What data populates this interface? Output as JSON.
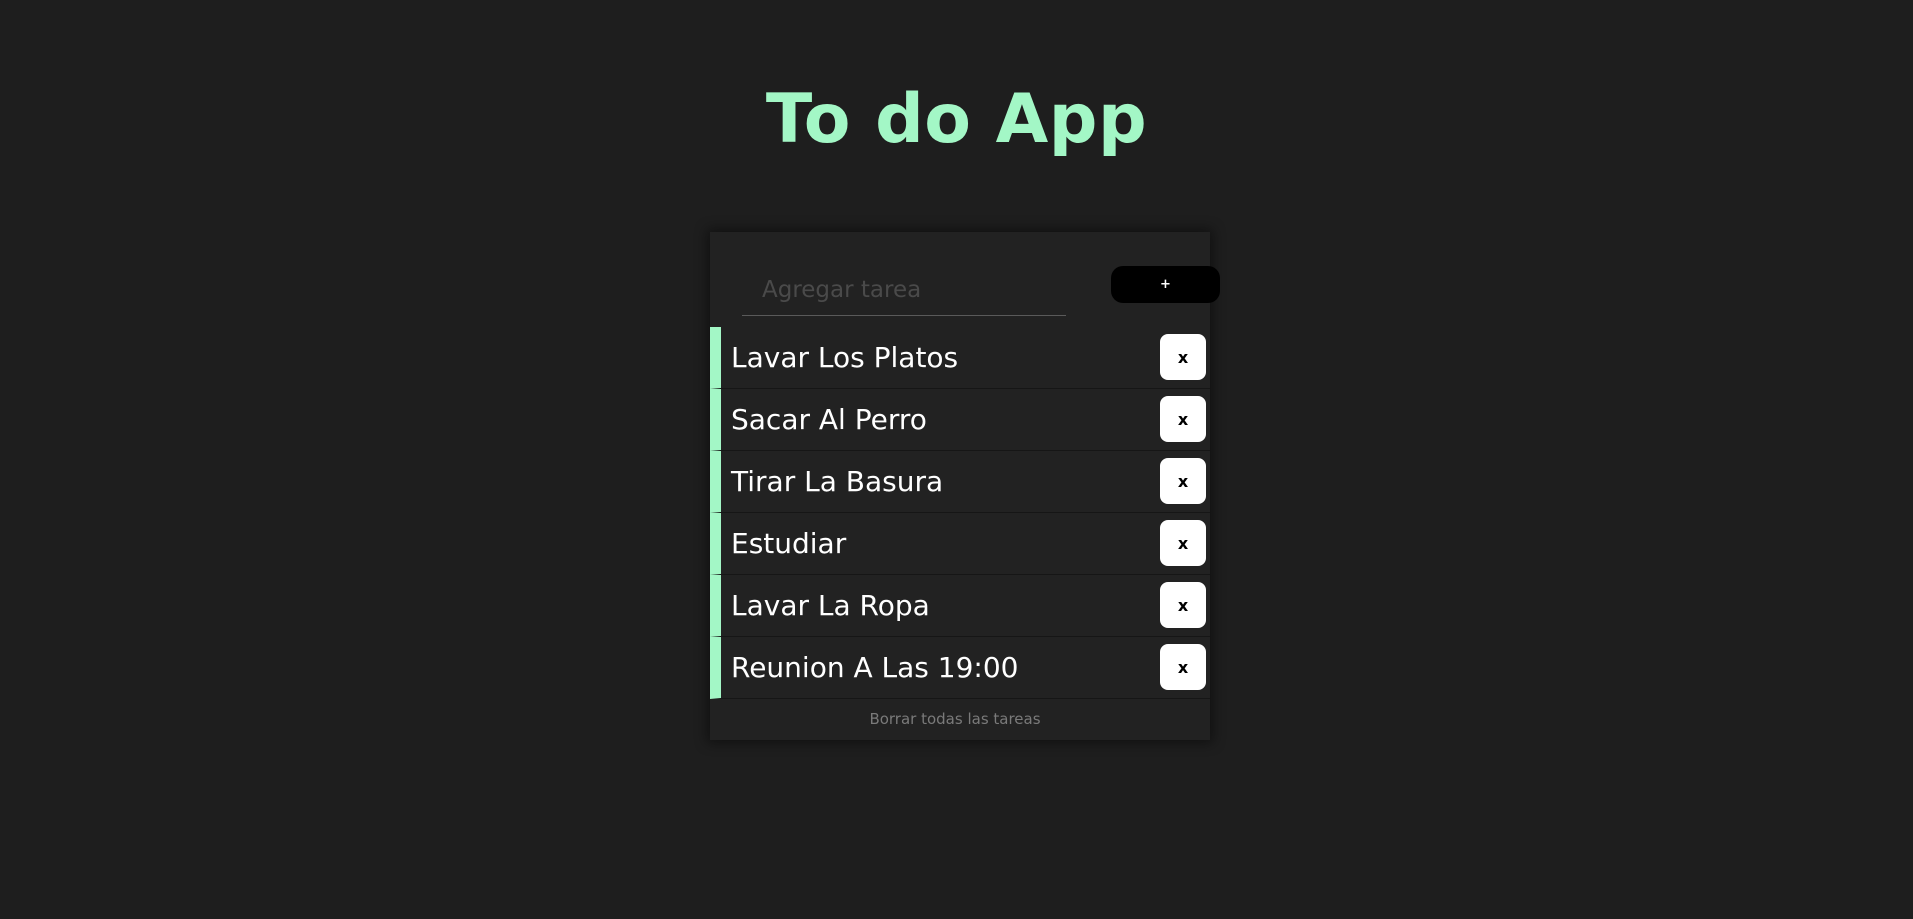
{
  "app": {
    "title": "To do App"
  },
  "input": {
    "placeholder": "Agregar tarea",
    "value": ""
  },
  "add_button": {
    "label": "+"
  },
  "tasks": [
    {
      "text": "Lavar Los Platos",
      "delete_label": "x"
    },
    {
      "text": "Sacar Al Perro",
      "delete_label": "x"
    },
    {
      "text": "Tirar La Basura",
      "delete_label": "x"
    },
    {
      "text": "Estudiar",
      "delete_label": "x"
    },
    {
      "text": "Lavar La Ropa",
      "delete_label": "x"
    },
    {
      "text": "Reunion A Las 19:00",
      "delete_label": "x"
    }
  ],
  "footer": {
    "clear_all_label": "Borrar todas las tareas"
  },
  "colors": {
    "background": "#1e1e1e",
    "accent": "#a3f7c6",
    "card": "#222222"
  }
}
